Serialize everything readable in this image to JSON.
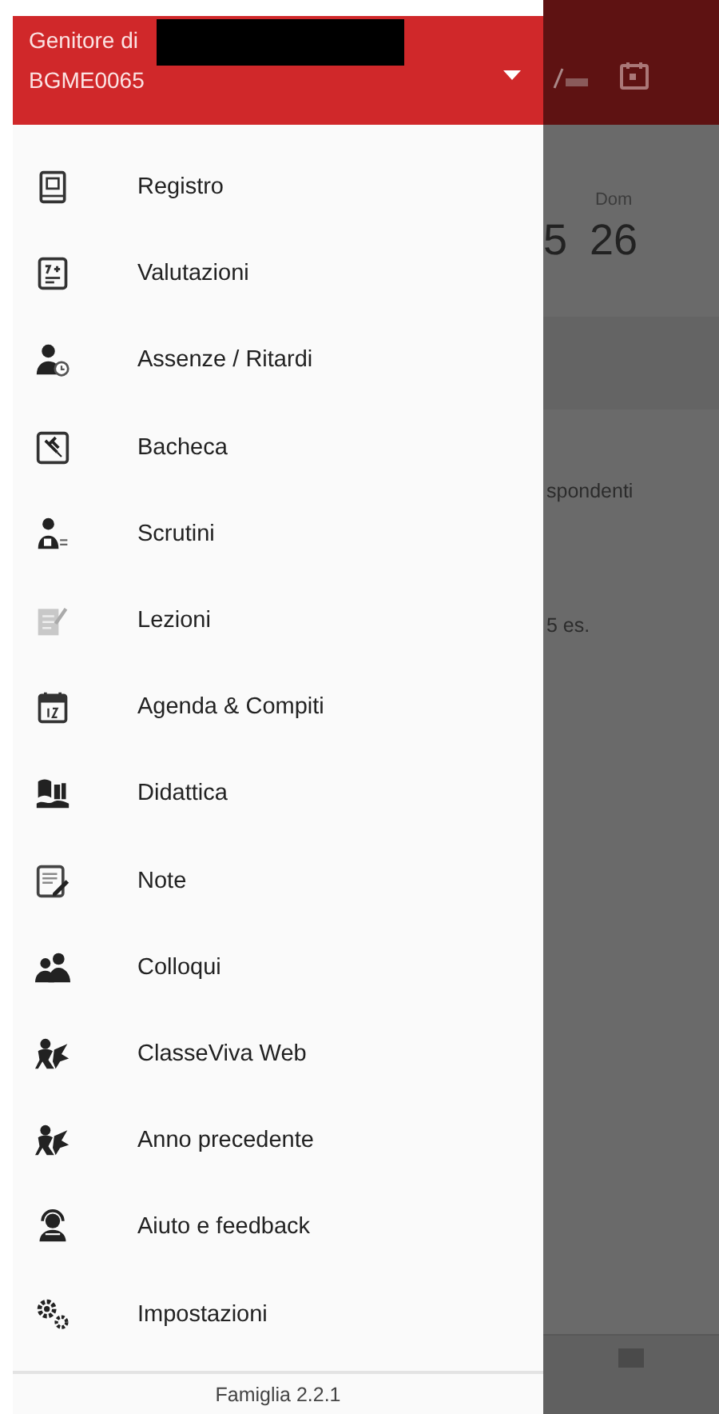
{
  "drawer": {
    "header": {
      "title": "Genitore di",
      "account": "BGME0065"
    },
    "items": [
      {
        "label": "Registro"
      },
      {
        "label": "Valutazioni"
      },
      {
        "label": "Assenze / Ritardi"
      },
      {
        "label": "Bacheca"
      },
      {
        "label": "Scrutini"
      },
      {
        "label": "Lezioni"
      },
      {
        "label": "Agenda & Compiti"
      },
      {
        "label": "Didattica"
      },
      {
        "label": "Note"
      },
      {
        "label": "Colloqui"
      },
      {
        "label": "ClasseViva Web"
      },
      {
        "label": "Anno precedente"
      },
      {
        "label": "Aiuto e feedback"
      },
      {
        "label": "Impostazioni"
      }
    ],
    "footer": "Famiglia 2.2.1"
  },
  "background": {
    "days": [
      {
        "number": "5"
      },
      {
        "label": "Dom",
        "number": "26"
      }
    ],
    "lines": [
      "spondenti",
      "5 es."
    ]
  }
}
